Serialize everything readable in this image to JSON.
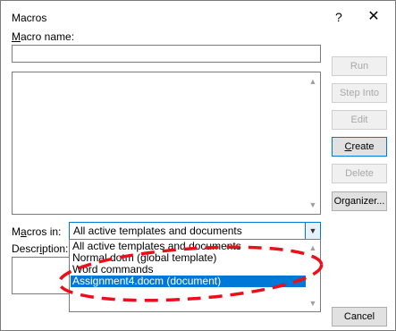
{
  "dialog": {
    "title": "Macros",
    "help_glyph": "?",
    "close_glyph": "✕"
  },
  "macro_name": {
    "label": "Macro name:",
    "accesskey": "M",
    "rest": "acro name:",
    "value": ""
  },
  "buttons": {
    "run": "Run",
    "step_into": "Step Into",
    "edit": "Edit",
    "create_accel": "C",
    "create_rest": "reate",
    "delete": "Delete",
    "organizer": "Organizer...",
    "cancel": "Cancel"
  },
  "macros_in": {
    "label_pre": "M",
    "label_accel": "a",
    "label_post": "cros in:",
    "selected": "All active templates and documents",
    "options": [
      "All active templates and documents",
      "Normal.dotm (global template)",
      "Word commands",
      "Assignment4.docm (document)"
    ],
    "highlighted_index": 3
  },
  "description": {
    "label_pre": "Descr",
    "label_accel": "i",
    "label_post": "ption:"
  },
  "colors": {
    "accent": "#0078d7",
    "annotation": "#e8101a",
    "disabled_text": "#a8a8a8"
  },
  "icons": {
    "scroll_up": "chevron-up-icon",
    "scroll_down": "chevron-down-icon"
  }
}
